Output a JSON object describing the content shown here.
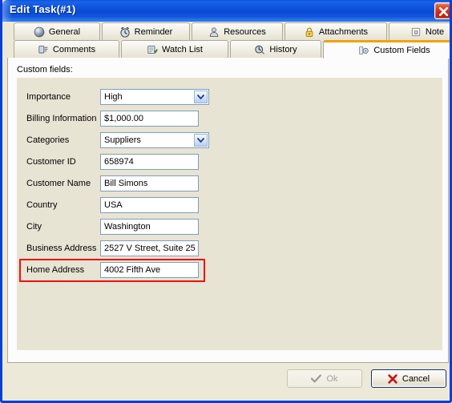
{
  "window": {
    "title": "Edit Task(#1)",
    "close_icon": "close-icon",
    "accent_color": "#0a3fd6",
    "titlebar_color": "#1157e0",
    "panel_color": "#e8e4d4",
    "highlight_color": "#ee1111"
  },
  "tabs": {
    "row1": [
      {
        "label": "General",
        "icon": "sphere-icon",
        "active": false
      },
      {
        "label": "Reminder",
        "icon": "alarm-clock-icon",
        "active": false
      },
      {
        "label": "Resources",
        "icon": "person-icon",
        "active": false
      },
      {
        "label": "Attachments",
        "icon": "lock-icon",
        "active": false
      },
      {
        "label": "Note",
        "icon": "pushpin-note-icon",
        "active": false
      }
    ],
    "row2": [
      {
        "label": "Comments",
        "icon": "comment-card-icon",
        "active": false
      },
      {
        "label": "Watch List",
        "icon": "watch-list-icon",
        "active": false
      },
      {
        "label": "History",
        "icon": "clock-history-icon",
        "active": false
      },
      {
        "label": "Custom Fields",
        "icon": "gear-fields-icon",
        "active": true
      }
    ]
  },
  "form": {
    "section_label": "Custom fields:",
    "fields": [
      {
        "label": "Importance",
        "value": "High",
        "type": "combo"
      },
      {
        "label": "Billing Information",
        "value": "$1,000.00",
        "type": "text"
      },
      {
        "label": "Categories",
        "value": "Suppliers",
        "type": "combo"
      },
      {
        "label": "Customer ID",
        "value": "658974",
        "type": "text"
      },
      {
        "label": "Customer Name",
        "value": "Bill Simons",
        "type": "text"
      },
      {
        "label": "Country",
        "value": "USA",
        "type": "text"
      },
      {
        "label": "City",
        "value": "Washington",
        "type": "text"
      },
      {
        "label": "Business Address",
        "value": "2527 V Street, Suite 25",
        "type": "text"
      },
      {
        "label": "Home Address",
        "value": "4002 Fifth Ave",
        "type": "text",
        "highlighted": true
      }
    ]
  },
  "footer": {
    "ok_label": "Ok",
    "ok_icon": "checkmark-icon",
    "ok_disabled": true,
    "cancel_label": "Cancel",
    "cancel_icon": "x-mark-icon",
    "cancel_focused": true
  }
}
